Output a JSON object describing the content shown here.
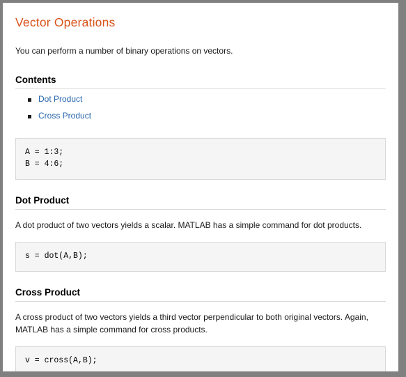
{
  "document": {
    "title": "Vector Operations",
    "intro": "You can perform a number of binary operations on vectors.",
    "contents_heading": "Contents",
    "contents_items": [
      {
        "label": "Dot Product"
      },
      {
        "label": "Cross Product"
      }
    ],
    "setup_code": "A = 1:3;\nB = 4:6;",
    "sections": [
      {
        "heading": "Dot Product",
        "paragraph": "A dot product of two vectors yields a scalar. MATLAB has a simple command for dot products.",
        "code": "s = dot(A,B);"
      },
      {
        "heading": "Cross Product",
        "paragraph": "A cross product of two vectors yields a third vector perpendicular to both original vectors. Again, MATLAB has a simple command for cross products.",
        "code": "v = cross(A,B);"
      }
    ]
  },
  "colors": {
    "title": "#d95319",
    "link": "#2565ae",
    "code_background": "#f5f5f5",
    "code_border": "#d9d9d9",
    "rule": "#d9d9d9",
    "window_border": "#808080",
    "page_background": "#ffffff"
  }
}
